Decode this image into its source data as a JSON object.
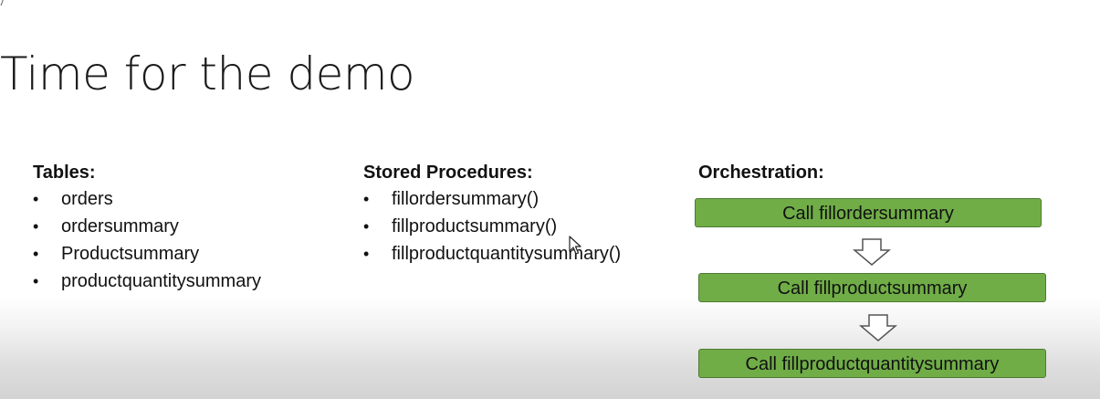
{
  "slide": {
    "title": "Time for the demo",
    "tables": {
      "heading": "Tables:",
      "items": [
        "orders",
        "ordersummary",
        "Productsummary",
        "productquantitysummary"
      ]
    },
    "stored_procedures": {
      "heading": "Stored Procedures:",
      "items": [
        "fillordersummary()",
        "fillproductsummary()",
        "fillproductquantitysummary()"
      ]
    },
    "orchestration": {
      "heading": "Orchestration:",
      "steps": [
        "Call fillordersummary",
        "Call fillproductsummary",
        "Call fillproductquantitysummary"
      ]
    }
  },
  "colors": {
    "step_fill": "#70ad47",
    "step_border": "#4e7a31"
  },
  "icons": {
    "bullet": "•",
    "arrow": "down-arrow-icon",
    "cursor": "mouse-pointer-icon"
  }
}
